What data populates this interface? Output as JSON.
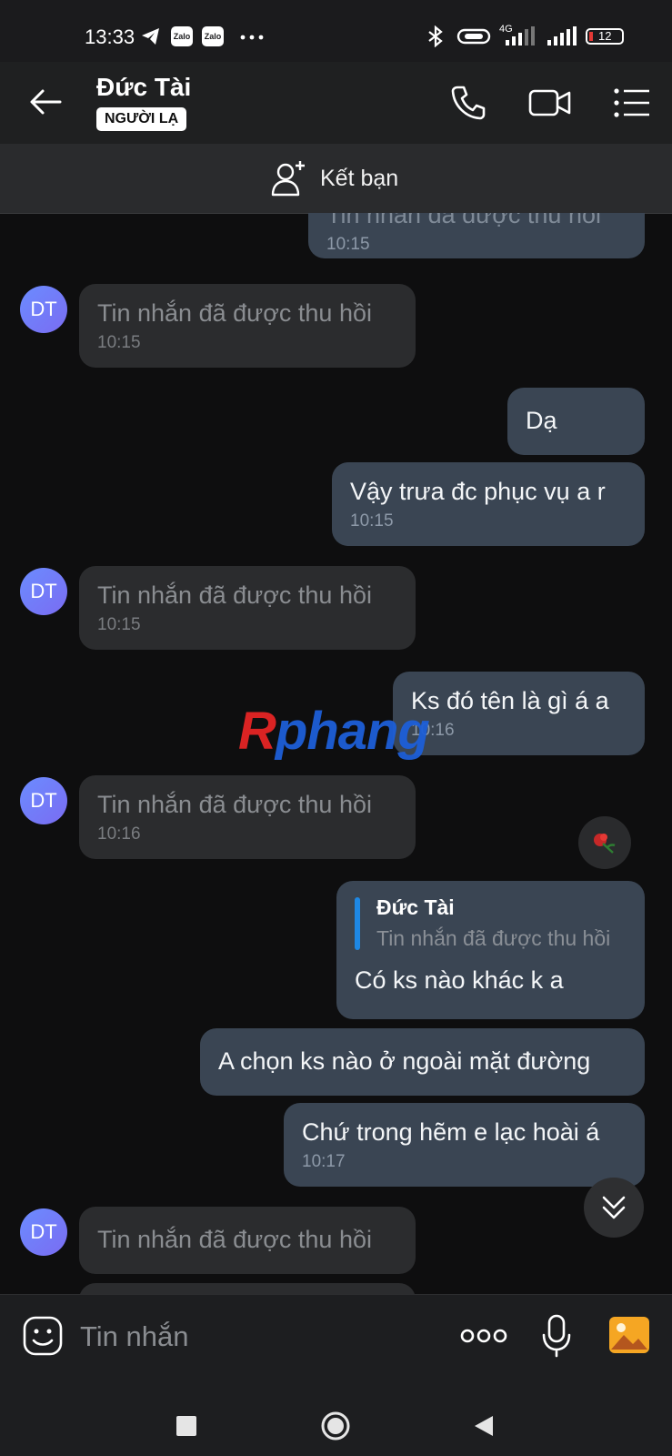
{
  "status_bar": {
    "time": "13:33",
    "battery": "12",
    "network": "4G",
    "icons": [
      "telegram-icon",
      "zalo-icon",
      "zalo-icon",
      "more-dots-icon",
      "bluetooth-icon",
      "link-icon",
      "signal-icon",
      "wifi-signal-icon",
      "battery-icon"
    ],
    "zalo_label": "Zalo"
  },
  "header": {
    "contact_name": "Đức Tài",
    "badge": "NGƯỜI LẠ",
    "icons": [
      "back-arrow-icon",
      "phone-icon",
      "video-call-icon",
      "menu-icon"
    ]
  },
  "friend_bar": {
    "label": "Kết bạn",
    "icon": "add-friend-icon"
  },
  "messages": [
    {
      "dir": "out",
      "text": "Tin nhắn đã được thu hồi",
      "time": "10:15"
    },
    {
      "dir": "in",
      "avatar": "DT",
      "text": "Tin nhắn đã được thu hồi",
      "time": "10:15"
    },
    {
      "dir": "out",
      "text": "Dạ",
      "time": ""
    },
    {
      "dir": "out",
      "text": "Vậy trưa đc phục vụ a r",
      "time": "10:15"
    },
    {
      "dir": "in",
      "avatar": "DT",
      "text": "Tin nhắn đã được thu hồi",
      "time": "10:15"
    },
    {
      "dir": "out",
      "text": "Ks đó tên là gì á a",
      "time": "10:16"
    },
    {
      "dir": "in",
      "avatar": "DT",
      "text": "Tin nhắn đã được thu hồi",
      "time": "10:16"
    },
    {
      "dir": "out",
      "quote_name": "Đức Tài",
      "quote_text": "Tin nhắn đã được thu hồi",
      "text": "Có ks nào khác k a",
      "time": ""
    },
    {
      "dir": "out",
      "text": "A chọn ks nào ở ngoài mặt đường",
      "time": ""
    },
    {
      "dir": "out",
      "text": "Chứ trong hẽm e lạc hoài á",
      "time": "10:17"
    },
    {
      "dir": "in",
      "avatar": "DT",
      "text": "Tin nhắn đã được thu hồi",
      "time": ""
    }
  ],
  "reaction": {
    "icon": "rose-reaction-icon"
  },
  "watermark": {
    "part1": "R",
    "part2": "phang"
  },
  "input_bar": {
    "placeholder": "Tin nhắn",
    "icons": [
      "sticker-icon",
      "more-options-icon",
      "microphone-icon",
      "gallery-icon"
    ]
  },
  "nav_bar": {
    "icons": [
      "recent-apps-icon",
      "home-icon",
      "back-icon"
    ]
  }
}
